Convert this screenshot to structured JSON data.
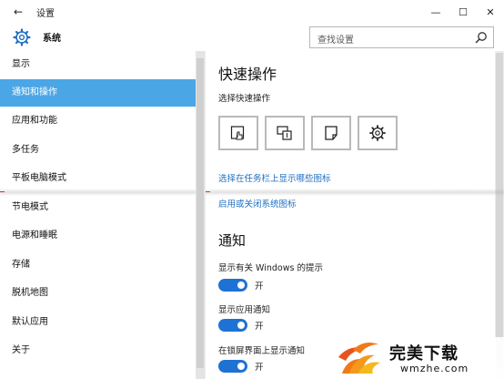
{
  "window": {
    "back_glyph": "←",
    "title": "设置",
    "minimize_glyph": "—",
    "maximize_glyph": "☐",
    "close_glyph": "✕"
  },
  "header": {
    "app_title": "系统",
    "app_icon": "gear-icon",
    "search_placeholder": "查找设置",
    "search_icon": "search-icon"
  },
  "sidebar": {
    "items": [
      {
        "label": "显示",
        "selected": false
      },
      {
        "label": "通知和操作",
        "selected": true
      },
      {
        "label": "应用和功能",
        "selected": false
      },
      {
        "label": "多任务",
        "selected": false
      },
      {
        "label": "平板电脑模式",
        "selected": false
      },
      {
        "label": "节电模式",
        "selected": false
      },
      {
        "label": "电源和睡眠",
        "selected": false
      },
      {
        "label": "存储",
        "selected": false
      },
      {
        "label": "脱机地图",
        "selected": false
      },
      {
        "label": "默认应用",
        "selected": false
      },
      {
        "label": "关于",
        "selected": false
      }
    ],
    "selected_color": "#4ba6e6"
  },
  "content": {
    "quick_actions": {
      "heading": "快速操作",
      "subheading": "选择快速操作",
      "buttons": [
        {
          "icon": "tablet-mode-icon"
        },
        {
          "icon": "project-icon"
        },
        {
          "icon": "note-icon"
        },
        {
          "icon": "settings-gear-icon"
        }
      ]
    },
    "links": {
      "taskbar_icons": "选择在任务栏上显示哪些图标",
      "system_icons": "启用或关闭系统图标"
    },
    "notifications": {
      "heading": "通知",
      "settings": [
        {
          "label": "显示有关 Windows 的提示",
          "state": "开",
          "on": true
        },
        {
          "label": "显示应用通知",
          "state": "开",
          "on": true
        },
        {
          "label": "在锁屏界面上显示通知",
          "state": "开",
          "on": true
        }
      ]
    },
    "link_color": "#1f6fc2",
    "toggle_color": "#1e72d4"
  },
  "watermark": {
    "name": "完美下载",
    "url": "wmzhe.com"
  }
}
